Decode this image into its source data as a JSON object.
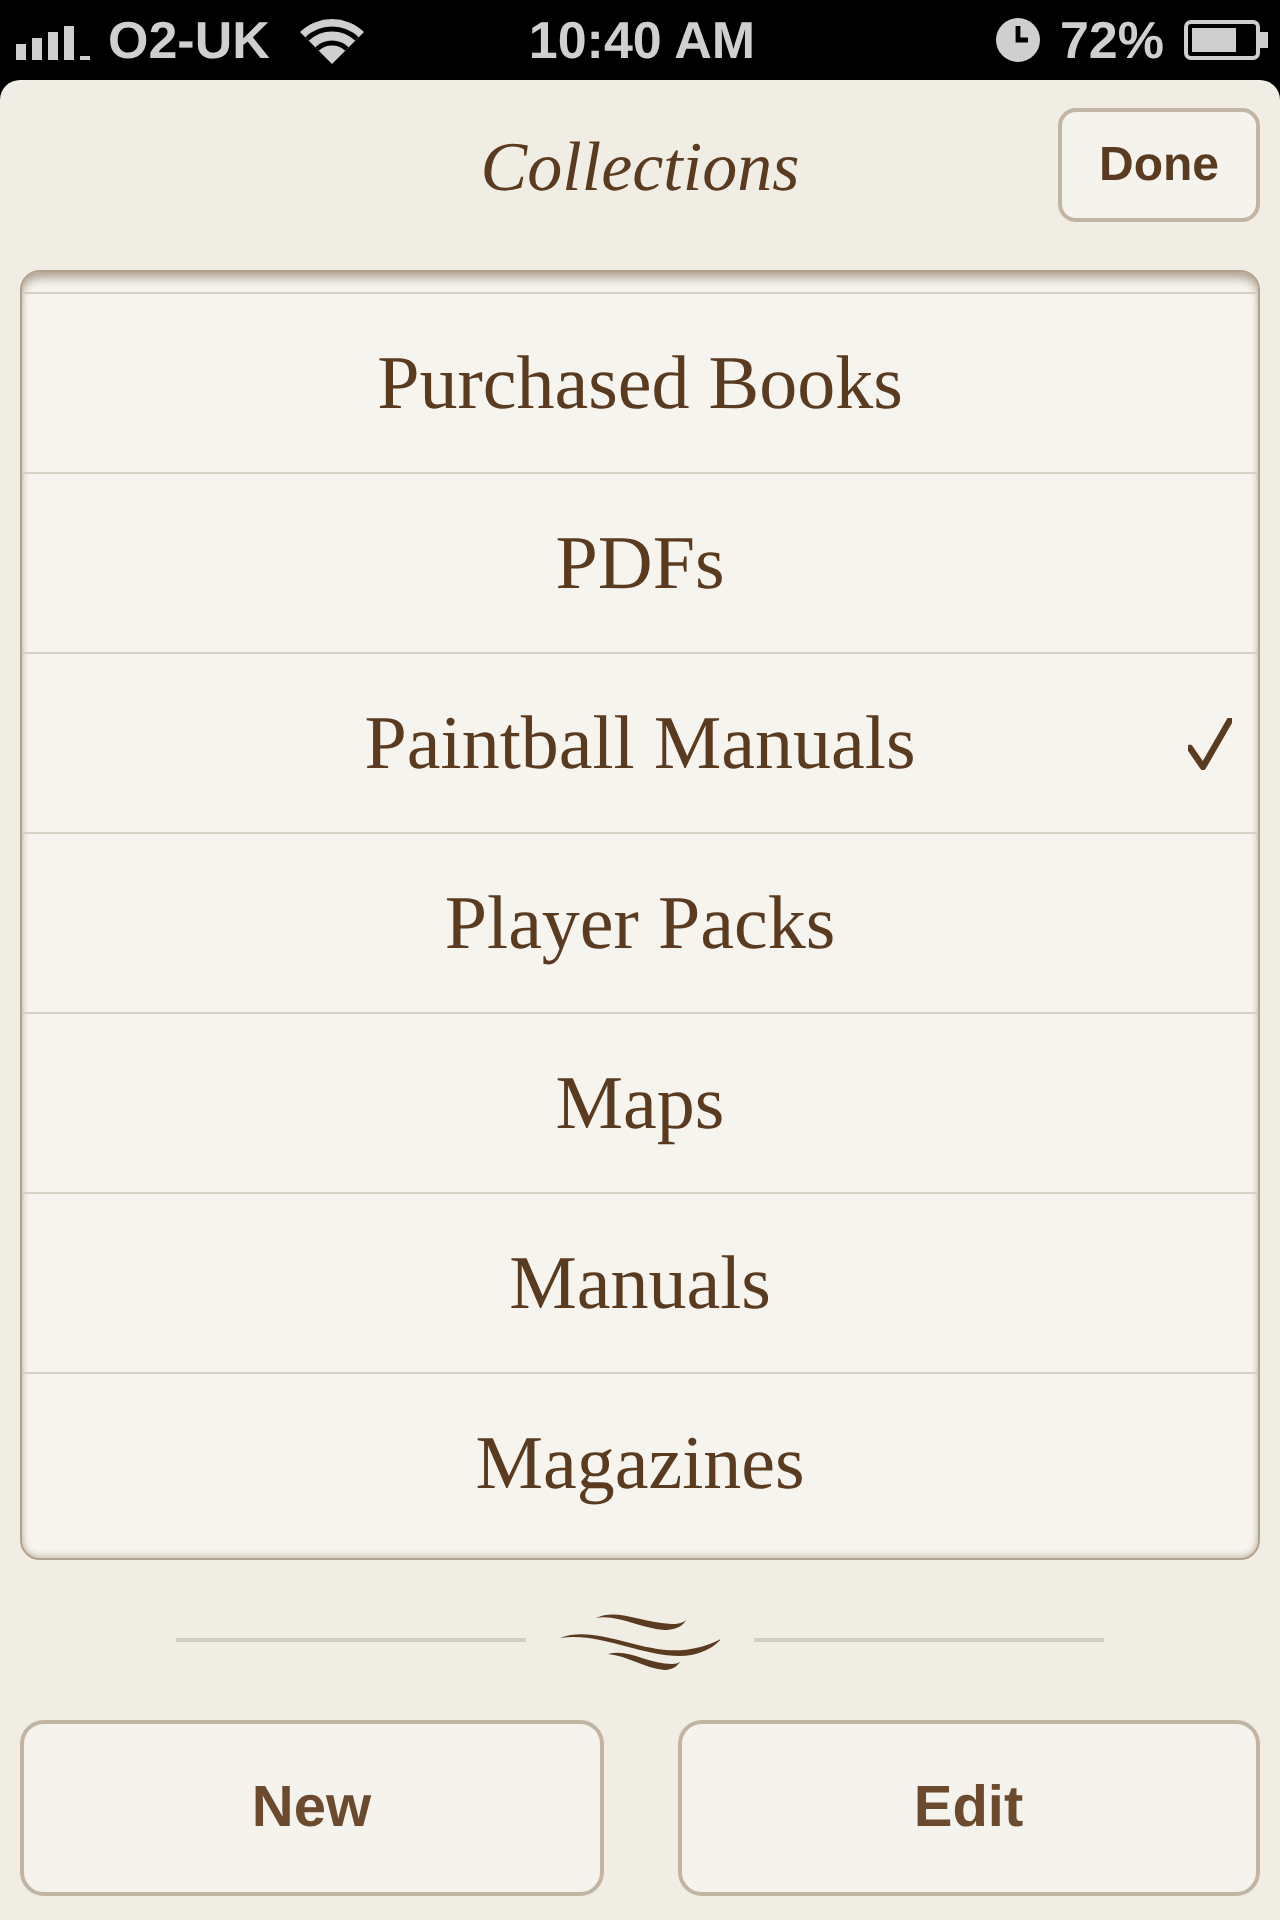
{
  "status_bar": {
    "carrier": "O2-UK",
    "time": "10:40 AM",
    "battery": "72%"
  },
  "header": {
    "title": "Collections",
    "done_button": "Done"
  },
  "collections": [
    {
      "label": "Purchased Books",
      "selected": false
    },
    {
      "label": "PDFs",
      "selected": false
    },
    {
      "label": "Paintball Manuals",
      "selected": true
    },
    {
      "label": "Player Packs",
      "selected": false
    },
    {
      "label": "Maps",
      "selected": false
    },
    {
      "label": "Manuals",
      "selected": false
    },
    {
      "label": "Magazines",
      "selected": false
    }
  ],
  "buttons": [
    {
      "label": "New"
    },
    {
      "label": "Edit"
    }
  ]
}
